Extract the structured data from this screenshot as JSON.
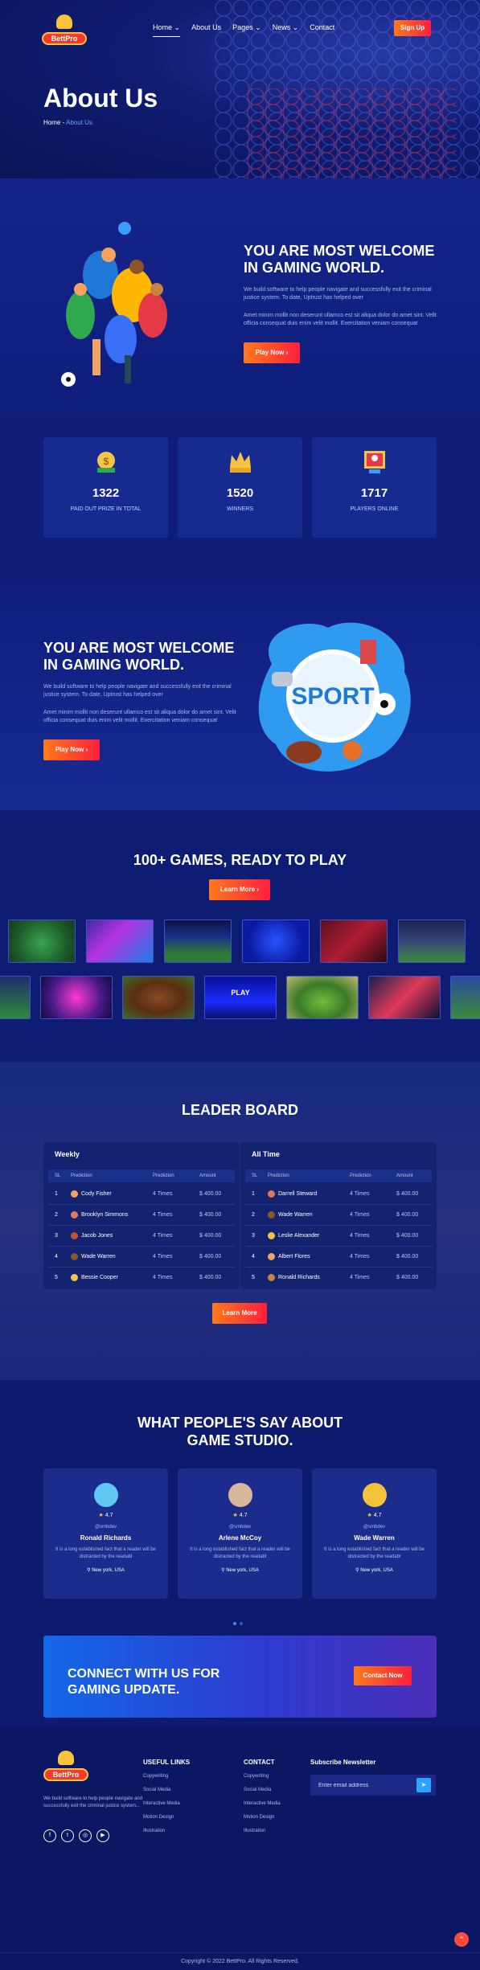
{
  "brand": {
    "logo_text": "BettPro"
  },
  "nav": {
    "items": [
      {
        "label": "Home",
        "chevron": "chevron-down-icon"
      },
      {
        "label": "About Us"
      },
      {
        "label": "Pages",
        "chevron": "chevron-down-icon"
      },
      {
        "label": "News",
        "chevron": "chevron-down-icon"
      },
      {
        "label": "Contact"
      }
    ],
    "signup": "Sign Up"
  },
  "hero": {
    "title": "About Us",
    "crumb_home": "Home",
    "crumb_sep": " - ",
    "crumb_current": "About Us"
  },
  "welcome1": {
    "title": "YOU ARE MOST WELCOME IN GAMING WORLD.",
    "text1": "We build software to help people navigate and successfully exit the criminal justice system. To date, Uptrust has helped over",
    "text2": "Amet minim mollit non deserunt ullamco est sit aliqua dolor do amet sint. Velit officia consequat duis enim velit mollit. Exercitation veniam consequat",
    "button": "Play Now"
  },
  "stats": [
    {
      "value": "1322",
      "label": "PAID OUT PRIZE IN TOTAL",
      "icon": "prize-bag-icon"
    },
    {
      "value": "1520",
      "label": "WINNERS",
      "icon": "winner-crown-icon"
    },
    {
      "value": "1717",
      "label": "PLAYERS ONLINE",
      "icon": "players-online-icon"
    }
  ],
  "welcome2": {
    "title": "YOU ARE MOST WELCOME IN GAMING WORLD.",
    "text1": "We build software to help people navigate and successfully exit the criminal justice system. To date, Uptrust has helped over",
    "text2": "Amet minim mollit non deserunt ullamco est sit aliqua dolor do amet sint. Velit officia consequat duis enim velit mollit. Exercitation veniam consequat",
    "button": "Play Now",
    "art_text": "SPORT"
  },
  "games": {
    "title": "100+ GAMES, READY TO PLAY",
    "button": "Learn More",
    "thumb_label": "PLAY"
  },
  "leaderboard": {
    "title": "LEADER BOARD",
    "button": "Learn More",
    "headers": {
      "sl": "SL",
      "prediction": "Prediction",
      "prediction2": "Prediction",
      "amount": "Amount"
    },
    "weekly": {
      "title": "Weekly",
      "rows": [
        {
          "sl": "1",
          "name": "Cody Fisher",
          "times": "4 Times",
          "amount": "$ 400.00"
        },
        {
          "sl": "2",
          "name": "Brooklyn Simmons",
          "times": "4 Times",
          "amount": "$ 400.00"
        },
        {
          "sl": "3",
          "name": "Jacob Jones",
          "times": "4 Times",
          "amount": "$ 400.00"
        },
        {
          "sl": "4",
          "name": "Wade Warren",
          "times": "4 Times",
          "amount": "$ 400.00"
        },
        {
          "sl": "5",
          "name": "Bessie Cooper",
          "times": "4 Times",
          "amount": "$ 400.00"
        }
      ]
    },
    "alltime": {
      "title": "All Time",
      "rows": [
        {
          "sl": "1",
          "name": "Darrell Steward",
          "times": "4 Times",
          "amount": "$ 400.00"
        },
        {
          "sl": "2",
          "name": "Wade Warren",
          "times": "4 Times",
          "amount": "$ 400.00"
        },
        {
          "sl": "3",
          "name": "Leslie Alexander",
          "times": "4 Times",
          "amount": "$ 400.00"
        },
        {
          "sl": "4",
          "name": "Albert Flores",
          "times": "4 Times",
          "amount": "$ 400.00"
        },
        {
          "sl": "5",
          "name": "Ronald Richards",
          "times": "4 Times",
          "amount": "$ 400.00"
        }
      ]
    }
  },
  "testimonials": {
    "title_line1": "WHAT PEOPLE'S SAY ABOUT",
    "title_line2": "GAME STUDIO.",
    "cards": [
      {
        "rating": "4.7",
        "handle": "@smbdev",
        "name": "Ronald Richards",
        "text": "It is a long established fact that a reader will be distracted by the readabl",
        "location": "New york, USA",
        "photo_color": "#5ec8f2"
      },
      {
        "rating": "4.7",
        "handle": "@smbdev",
        "name": "Arlene McCoy",
        "text": "It is a long established fact that a reader will be distracted by the readabl",
        "location": "New york, USA",
        "photo_color": "#d9b89a"
      },
      {
        "rating": "4.7",
        "handle": "@smbdev",
        "name": "Wade Warren",
        "text": "It is a long established fact that a reader will be distracted by the readabl",
        "location": "New york, USA",
        "photo_color": "#f3c33c"
      }
    ]
  },
  "connect": {
    "title_line1": "CONNECT WITH US FOR",
    "title_line2": "GAMING UPDATE.",
    "button": "Contact Now"
  },
  "footer": {
    "about": "We build software to help people navigate and successfully exit the criminal justice system...",
    "social": [
      {
        "icon": "facebook-icon",
        "glyph": "f"
      },
      {
        "icon": "twitter-icon",
        "glyph": "t"
      },
      {
        "icon": "instagram-icon",
        "glyph": "◎"
      },
      {
        "icon": "youtube-icon",
        "glyph": "▶"
      }
    ],
    "useful_title": "USEFUL LINKS",
    "useful": [
      "Copywriting",
      "Social Media",
      "Interactive Media",
      "Motion Design",
      "Illustration"
    ],
    "contact_title": "CONTACT",
    "contact": [
      "Copywriting",
      "Social Media",
      "Interactive Media",
      "Motion Design",
      "Illustration"
    ],
    "newsletter_title": "Subscribe Newsletter",
    "newsletter_placeholder": "Enter email address",
    "copyright": "Copyright © 2022 BettPro. All Rights Reserved."
  },
  "colors": {
    "accent_orange": "#ff7a1a",
    "accent_red": "#ff1f3d",
    "primary_blue": "#1368e8",
    "bg_navy": "#0e1a6b"
  }
}
